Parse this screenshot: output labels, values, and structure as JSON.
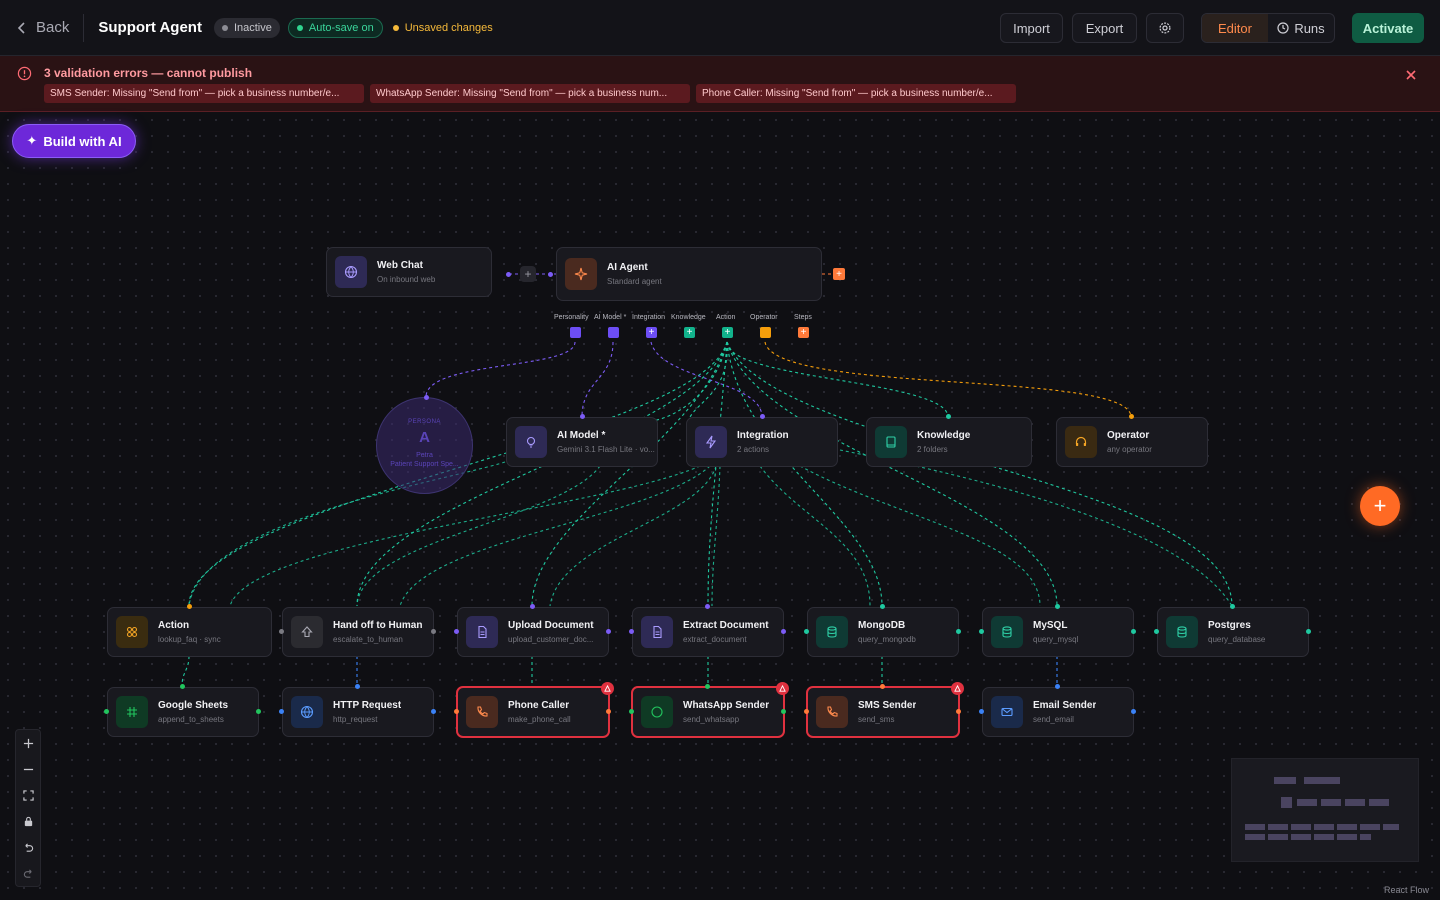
{
  "header": {
    "back_label": "Back",
    "agent_name": "Support Agent",
    "status": "Inactive",
    "autosave": "Auto-save on",
    "unsaved": "Unsaved changes",
    "import_label": "Import",
    "export_label": "Export",
    "tab_editor": "Editor",
    "tab_runs": "Runs",
    "activate_label": "Activate"
  },
  "errors": {
    "title": "3 validation errors — cannot publish",
    "items": [
      "SMS Sender: Missing \"Send from\" — pick a business number/e...",
      "WhatsApp Sender: Missing \"Send from\" — pick a business num...",
      "Phone Caller: Missing \"Send from\" — pick a business number/e..."
    ]
  },
  "build_ai": "Build with AI",
  "nodes": {
    "webchat": {
      "title": "Web Chat",
      "sub": "On inbound web"
    },
    "agent": {
      "title": "AI Agent",
      "sub": "Standard agent"
    },
    "aimodel": {
      "title": "AI Model *",
      "sub": "Gemini 3.1 Flash Lite · vo..."
    },
    "integration": {
      "title": "Integration",
      "sub": "2 actions"
    },
    "knowledge": {
      "title": "Knowledge",
      "sub": "2 folders"
    },
    "operator": {
      "title": "Operator",
      "sub": "any operator"
    },
    "action": {
      "title": "Action",
      "sub": "lookup_faq · sync"
    },
    "handoff": {
      "title": "Hand off to Human",
      "sub": "escalate_to_human"
    },
    "upload": {
      "title": "Upload Document",
      "sub": "upload_customer_doc..."
    },
    "extract": {
      "title": "Extract Document",
      "sub": "extract_document"
    },
    "mongodb": {
      "title": "MongoDB",
      "sub": "query_mongodb"
    },
    "mysql": {
      "title": "MySQL",
      "sub": "query_mysql"
    },
    "postgres": {
      "title": "Postgres",
      "sub": "query_database"
    },
    "gsheets": {
      "title": "Google Sheets",
      "sub": "append_to_sheets"
    },
    "http": {
      "title": "HTTP Request",
      "sub": "http_request"
    },
    "phone": {
      "title": "Phone Caller",
      "sub": "make_phone_call"
    },
    "whatsapp": {
      "title": "WhatsApp Sender",
      "sub": "send_whatsapp"
    },
    "sms": {
      "title": "SMS Sender",
      "sub": "send_sms"
    },
    "email": {
      "title": "Email Sender",
      "sub": "send_email"
    }
  },
  "slots": {
    "personality": "Personality",
    "aimodel": "AI Model *",
    "integration": "Integration",
    "knowledge": "Knowledge",
    "action": "Action",
    "operator": "Operator",
    "steps": "Steps"
  },
  "persona": {
    "label": "PERSONA",
    "initial": "A",
    "name": "Petra",
    "role": "Patient Support Spe..."
  },
  "attribution": "React Flow",
  "colors": {
    "accent_orange": "#ff6a24",
    "purple": "#7c5cf5",
    "teal": "#1fc9a0",
    "error_red": "#e0313f",
    "activate_green": "#0f5c43"
  }
}
